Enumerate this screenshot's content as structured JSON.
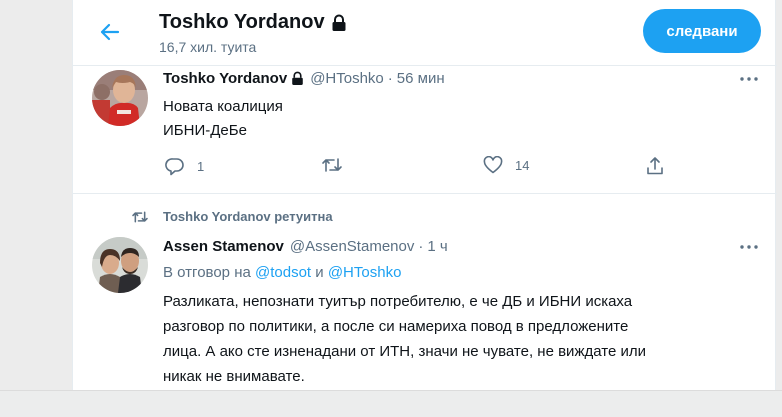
{
  "header": {
    "name": "Toshko Yordanov",
    "tweet_count": "16,7 хил. туита",
    "follow_label": "следвани"
  },
  "tweet1": {
    "name": "Toshko Yordanov",
    "handle": "@HToshko",
    "separator": "·",
    "time": "56 мин",
    "lines": [
      "Новата коалиция",
      "ИБНИ-ДеБе"
    ],
    "reply_count": "1",
    "retweet_count": "",
    "like_count": "14"
  },
  "retweet_label": "Toshko Yordanov ретуитна",
  "tweet2": {
    "name": "Assen Stamenov",
    "handle": "@AssenStamenov",
    "separator": "·",
    "time": "1 ч",
    "reply_prefix": "В отговор на",
    "mention1": "@todsot",
    "conj": "и",
    "mention2": "@HToshko",
    "lines": [
      "Разликата, непознати туитър потребителю, е че ДБ и ИБНИ искаха",
      "разговор по политики, а после си намериха повод в предложените",
      "лица. А ако сте изненадани от ИТН, значи не чувате, не виждате или",
      "никак не внимавате."
    ]
  },
  "colors": {
    "accent": "#1da1f2",
    "muted": "#5b7083",
    "text": "#0f1419"
  },
  "icons": [
    "back-arrow-icon",
    "lock-icon",
    "more-icon",
    "reply-icon",
    "retweet-icon",
    "like-icon",
    "share-icon"
  ]
}
